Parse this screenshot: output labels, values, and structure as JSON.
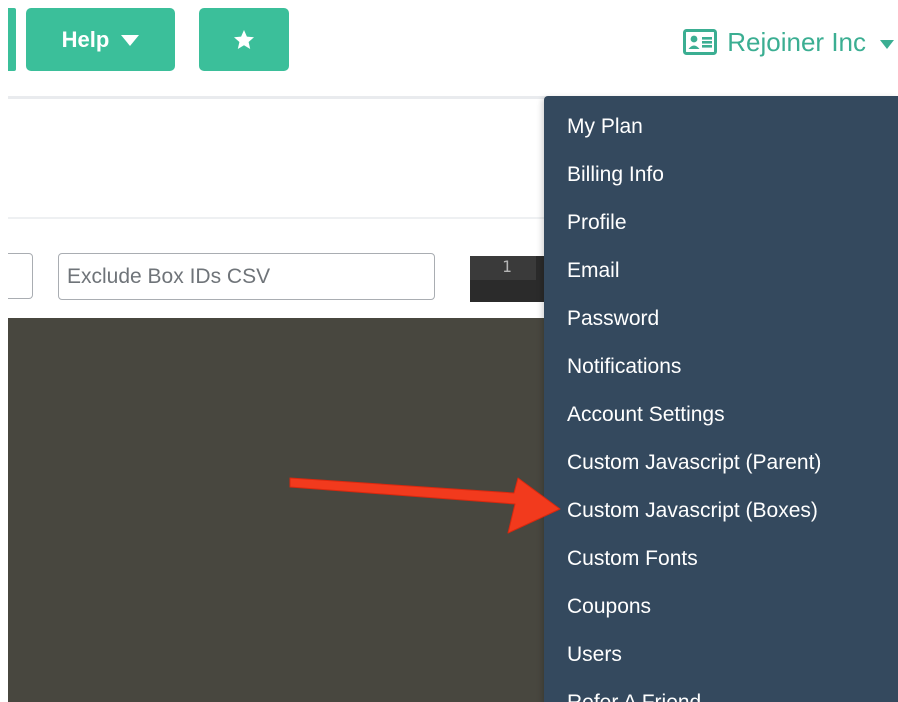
{
  "topbar": {
    "help_label": "Help",
    "favorite_icon": "star-icon",
    "account_icon": "id-card-icon",
    "account_name": "Rejoiner Inc"
  },
  "filters": {
    "exclude_placeholder": "Exclude Box IDs CSV",
    "exclude_value": ""
  },
  "editor": {
    "line_number": "1"
  },
  "account_menu": {
    "items": [
      {
        "label": "My Plan"
      },
      {
        "label": "Billing Info"
      },
      {
        "label": "Profile"
      },
      {
        "label": "Email"
      },
      {
        "label": "Password"
      },
      {
        "label": "Notifications"
      },
      {
        "label": "Account Settings"
      },
      {
        "label": "Custom Javascript (Parent)"
      },
      {
        "label": "Custom Javascript (Boxes)"
      },
      {
        "label": "Custom Fonts"
      },
      {
        "label": "Coupons"
      },
      {
        "label": "Users"
      },
      {
        "label": "Refer A Friend"
      }
    ]
  },
  "colors": {
    "accent": "#3bbf9a",
    "menu_bg": "#34495e",
    "editor_bg": "#48473f",
    "annotation_arrow": "#f23a1d"
  }
}
